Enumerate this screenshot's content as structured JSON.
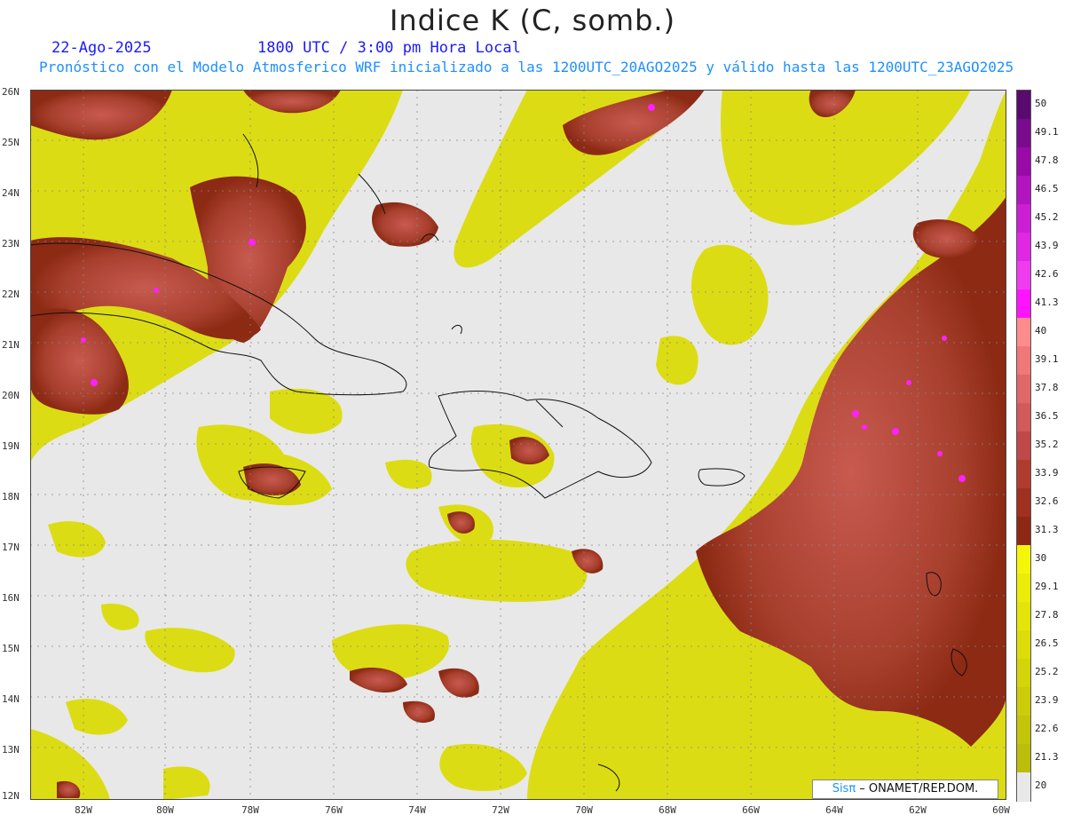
{
  "header": {
    "title": "Indice K (C, somb.)",
    "date": "22-Ago-2025",
    "time": "1800 UTC / 3:00 pm Hora Local",
    "forecast": "Pronóstico con el Modelo Atmosferico WRF inicializado a las 1200UTC_20AGO2025 y válido hasta las  1200UTC_23AGO2025"
  },
  "axes": {
    "lat_labels": [
      "26N",
      "25N",
      "24N",
      "23N",
      "22N",
      "21N",
      "20N",
      "19N",
      "18N",
      "17N",
      "16N",
      "15N",
      "14N",
      "13N",
      "12N"
    ],
    "lon_labels": [
      "82W",
      "80W",
      "78W",
      "76W",
      "74W",
      "72W",
      "70W",
      "68W",
      "66W",
      "64W",
      "62W",
      "60W"
    ]
  },
  "colorbar": {
    "labels": [
      "50",
      "49.1",
      "47.8",
      "46.5",
      "45.2",
      "43.9",
      "42.6",
      "41.3",
      "40",
      "39.1",
      "37.8",
      "36.5",
      "35.2",
      "33.9",
      "32.6",
      "31.3",
      "30",
      "29.1",
      "27.8",
      "26.5",
      "25.2",
      "23.9",
      "22.6",
      "21.3",
      "20"
    ],
    "colors": [
      "#5a0a6e",
      "#7a0a8e",
      "#9a0aa8",
      "#b414c0",
      "#cc1ed4",
      "#e028e4",
      "#f03cf0",
      "#ff14ff",
      "#ff8c8c",
      "#f07878",
      "#e06868",
      "#d25a5a",
      "#c04848",
      "#b03c30",
      "#a03020",
      "#8c2814",
      "#f5f50a",
      "#ecec0a",
      "#e4e40a",
      "#dcdc0a",
      "#d4d40a",
      "#cccc0a",
      "#c4c40a",
      "#bcbc0a",
      "#e8e8e8"
    ]
  },
  "credit": {
    "brand": "Sisπ",
    "text": " – ONAMET/REP.DOM."
  }
}
